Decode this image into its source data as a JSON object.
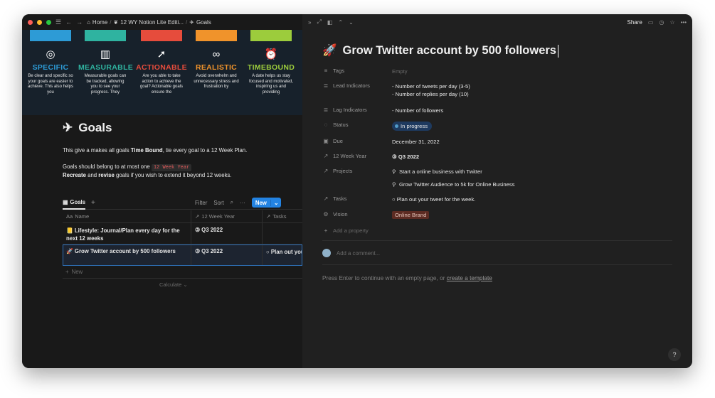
{
  "titlebar": {
    "breadcrumb": [
      "Home",
      "12 WY Notion Lite Editi...",
      "Goals"
    ]
  },
  "banner": {
    "columns": [
      {
        "title": "SPECIFIC",
        "color": "#2d9bd6",
        "icon": "target-icon",
        "text": "Be clear and specific so your goals are easier to achieve. This also helps you"
      },
      {
        "title": "MEASURABLE",
        "color": "#2fb3a0",
        "icon": "bar-chart-icon",
        "text": "Measurable goals can be tracked, allowing you to see your progress. They"
      },
      {
        "title": "ACTIONABLE",
        "color": "#e64c3c",
        "icon": "rocket-icon",
        "text": "Are you able to take action to achieve the goal? Actionable goals ensure the"
      },
      {
        "title": "REALISTIC",
        "color": "#f0932b",
        "icon": "glasses-icon",
        "text": "Avoid overwhelm and unnecessary stress and frustration by"
      },
      {
        "title": "TIMEBOUND",
        "color": "#9ccc3c",
        "icon": "alarm-clock-icon",
        "text": "A date helps us stay focused and motivated, inspiring us and providing"
      }
    ]
  },
  "page": {
    "title": "Goals",
    "line1_pre": "This give a makes all goals ",
    "line1_bold": "Time Bound",
    "line1_post": ", tie every goal to a 12 Week Plan.",
    "line2_pre": "Goals should belong to at most one",
    "line2_code": "12 Week Year",
    "line3_bold1": "Recreate",
    "line3_mid": " and ",
    "line3_bold2": "revise",
    "line3_post": " goals if you wish to extend it beyond 12 weeks."
  },
  "view": {
    "tab_label": "Goals",
    "filter": "Filter",
    "sort": "Sort",
    "new_label": "New"
  },
  "table": {
    "headers": [
      "Name",
      "12 Week Year",
      "Tasks"
    ],
    "rows": [
      {
        "name": "Lifestyle: Journal/Plan every day for the next 12 weeks",
        "year": "Q3 2022",
        "task": ""
      },
      {
        "name": "Grow Twitter account by 500 followers",
        "year": "Q3 2022",
        "task": "Plan out your tweet for the week."
      }
    ],
    "new_row": "New",
    "calculate": "Calculate"
  },
  "detail": {
    "share": "Share",
    "title": "Grow Twitter account by 500 followers",
    "props": {
      "tags": {
        "label": "Tags",
        "value": "Empty"
      },
      "lead": {
        "label": "Lead Indicators",
        "value1": "- Number of tweets per day (3-5)",
        "value2": "- Number of replies per day (10)"
      },
      "lag": {
        "label": "Lag Indicators",
        "value": "- Number of followers"
      },
      "status": {
        "label": "Status",
        "value": "In progress"
      },
      "due": {
        "label": "Due",
        "value": "December 31, 2022"
      },
      "year": {
        "label": "12 Week Year",
        "value": "Q3 2022"
      },
      "projects": {
        "label": "Projects",
        "value1": "Start a online business with Twitter",
        "value2": "Grow Twitter Audience to 5k for Online Business"
      },
      "tasks": {
        "label": "Tasks",
        "value": "Plan out your tweet for the week."
      },
      "vision": {
        "label": "Vision",
        "value": "Online Brand"
      }
    },
    "add_property": "Add a property",
    "comment_placeholder": "Add a comment...",
    "hint_pre": "Press Enter to continue with an empty page, or ",
    "hint_link": "create a template",
    "help": "?"
  }
}
